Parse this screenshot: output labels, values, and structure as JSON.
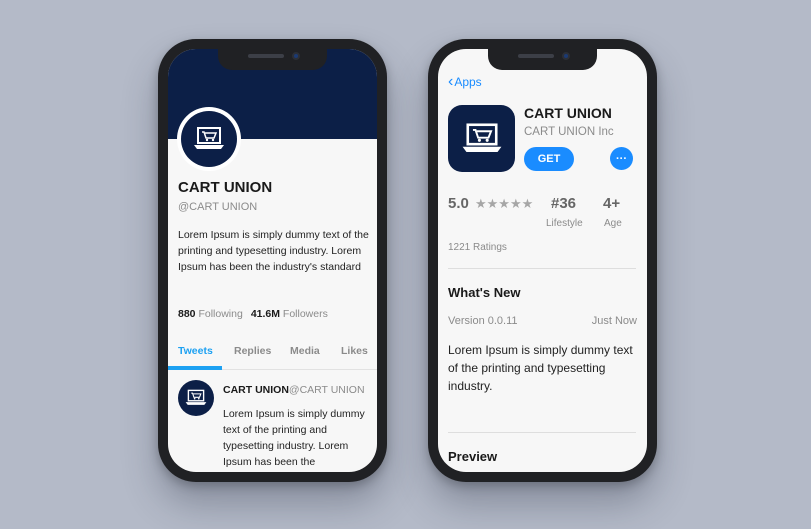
{
  "profile": {
    "name": "CART UNION",
    "handle": "@CART UNION",
    "bio": "Lorem Ipsum is simply dummy text of the printing and typesetting industry. Lorem Ipsum has been the industry's standard",
    "following_count": "880",
    "following_label": "Following",
    "followers_count": "41.6M",
    "followers_label": "Followers",
    "tabs": [
      "Tweets",
      "Replies",
      "Media",
      "Likes"
    ],
    "active_tab": "Tweets",
    "tweet": {
      "name": "CART UNION",
      "handle": "@CART UNION",
      "text": "Lorem Ipsum is simply dummy text of the printing and typesetting industry. Lorem Ipsum has been the"
    }
  },
  "appstore": {
    "back_label": "Apps",
    "app_name": "CART UNION",
    "developer": "CART UNION Inc",
    "get_label": "GET",
    "more_label": "···",
    "rating": "5.0",
    "stars": "★★★★★",
    "rank": "#36",
    "rank_category": "Lifestyle",
    "age": "4+",
    "age_label": "Age",
    "ratings_count": "1221 Ratings",
    "whats_new_title": "What's New",
    "version": "Version 0.0.11",
    "version_date": "Just Now",
    "whats_new_text": "Lorem Ipsum is simply dummy text of the printing and typesetting industry.",
    "preview_title": "Preview"
  },
  "colors": {
    "background": "#b4bac8",
    "brand_navy": "#0c1f47",
    "tab_accent": "#1da1f2",
    "store_blue": "#1a8cff"
  },
  "icons": {
    "logo": "cart-on-laptop-icon",
    "back": "chevron-left-icon",
    "more": "ellipsis-icon"
  }
}
